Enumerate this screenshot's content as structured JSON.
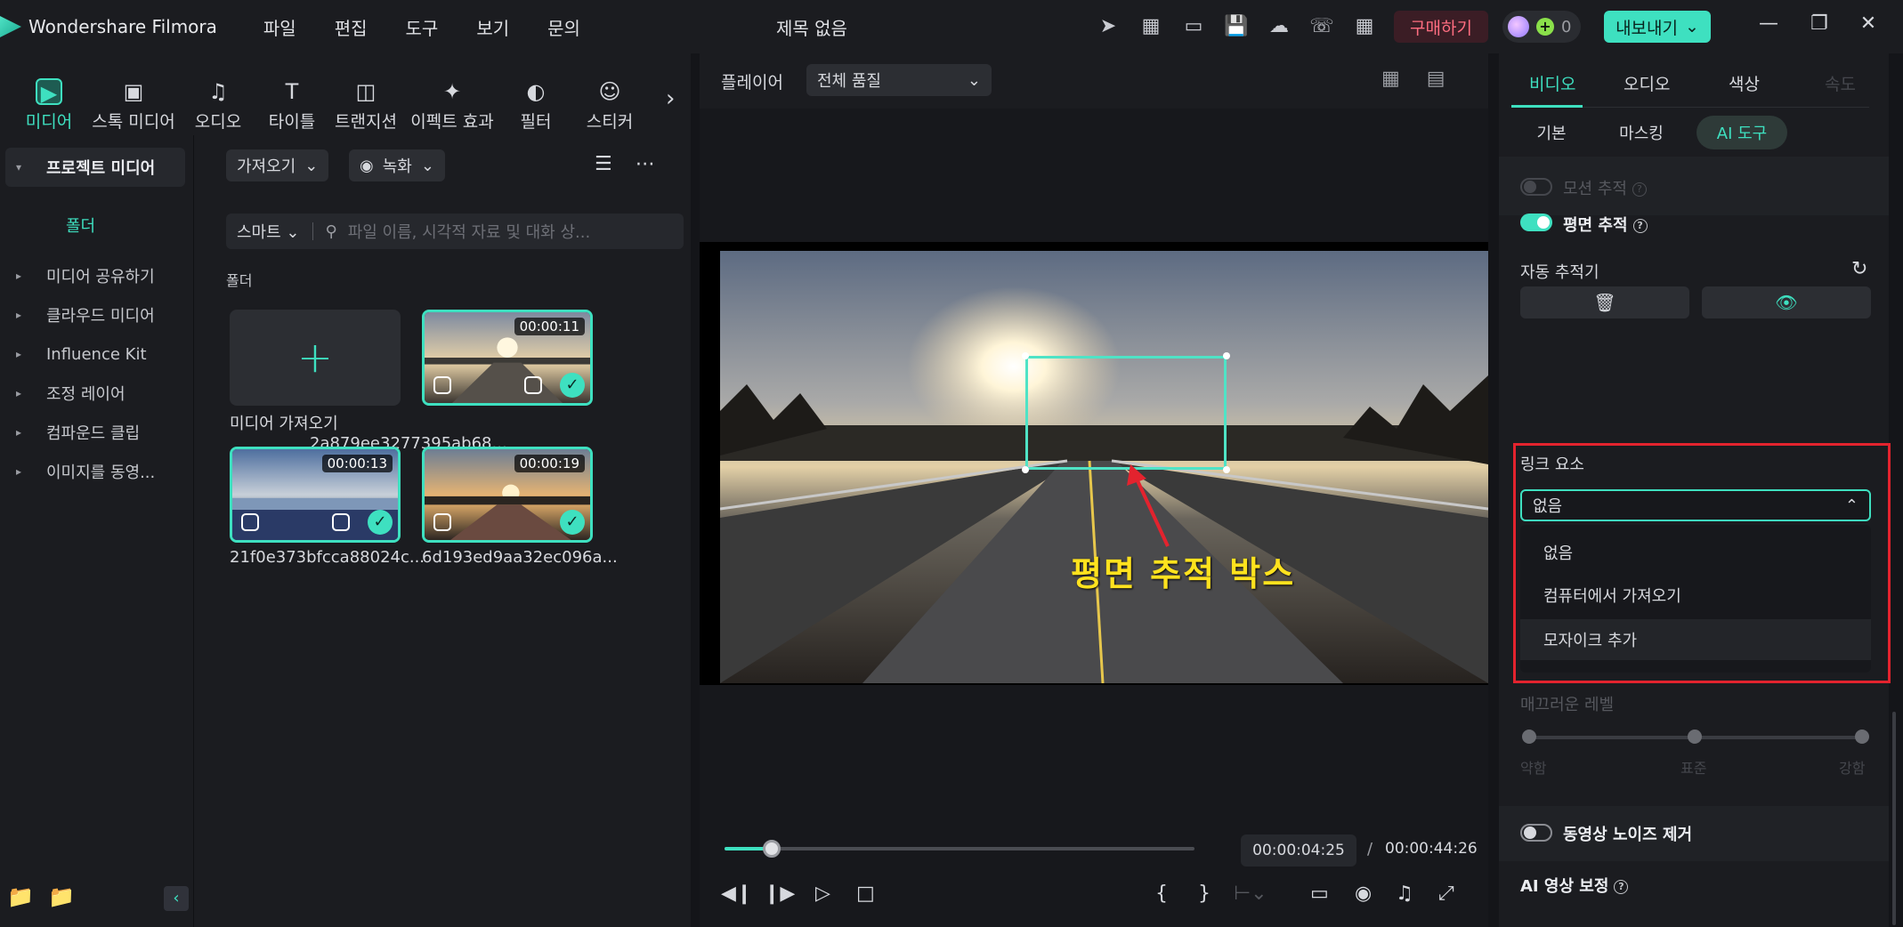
{
  "app": {
    "name": "Wondershare Filmora",
    "doc_title": "제목 없음",
    "menu": [
      "파일",
      "편집",
      "도구",
      "보기",
      "문의"
    ],
    "buy_label": "구매하기",
    "credits": "0",
    "export_label": "내보내기"
  },
  "media_tabs": [
    {
      "label": "미디어",
      "icon": "media-icon"
    },
    {
      "label": "스톡 미디어",
      "icon": "stock-icon"
    },
    {
      "label": "오디오",
      "icon": "music-note-icon"
    },
    {
      "label": "타이틀",
      "icon": "title-t-icon"
    },
    {
      "label": "트랜지션",
      "icon": "transition-icon"
    },
    {
      "label": "이펙트 효과",
      "icon": "effects-icon"
    },
    {
      "label": "필터",
      "icon": "filter-icon"
    },
    {
      "label": "스티커",
      "icon": "sticker-icon"
    }
  ],
  "sidebar": {
    "items": [
      "프로젝트 미디어",
      "미디어 공유하기",
      "클라우드 미디어",
      "Influence Kit",
      "조정 레이어",
      "컴파운드 클립",
      "이미지를 동영..."
    ],
    "sub": "폴더"
  },
  "library": {
    "import_label": "가져오기",
    "record_label": "녹화",
    "smart_label": "스마트",
    "search_placeholder": "파일 이름, 시각적 자료 및 대화 상...",
    "folder_label": "폴더",
    "import_tile_caption": "미디어 가져오기",
    "clips": [
      {
        "name": "2a879ee3277395ab68...",
        "duration": "00:00:11"
      },
      {
        "name": "21f0e373bfcca88024c...",
        "duration": "00:00:13"
      },
      {
        "name": "6d193ed9aa32ec096a...",
        "duration": "00:00:19"
      }
    ]
  },
  "player": {
    "title": "플레이어",
    "quality": "전체 품질",
    "annotation": "평면 추적 박스",
    "current_time": "00:00:04:25",
    "separator": "/",
    "total_time": "00:00:44:26",
    "progress_fraction": 0.1
  },
  "props": {
    "tabs": [
      "비디오",
      "오디오",
      "색상",
      "속도"
    ],
    "subtabs": [
      "기본",
      "마스킹",
      "AI 도구"
    ],
    "motion_tracking": "모션 추적",
    "planar_tracking": "평면 추적",
    "auto_tracker": "자동 추적기",
    "link_element": "링크 요소",
    "dropdown_value": "없음",
    "dropdown_options": [
      "없음",
      "컴퓨터에서 가져오기",
      "모자이크 추가"
    ],
    "smooth_level": "매끄러운 레벨",
    "smooth_labels": [
      "약함",
      "표준",
      "강함"
    ],
    "denoise": "동영상 노이즈 제거",
    "ai_enhance": "AI 영상 보정"
  },
  "colors": {
    "accent": "#3ee0c0",
    "highlight_border": "#e3232e",
    "annotation": "#ffe21e"
  }
}
